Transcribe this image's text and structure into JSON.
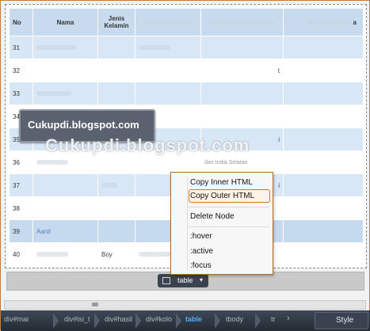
{
  "table": {
    "headers": [
      "No",
      "Nama",
      "Jenis Kelamin",
      "",
      "",
      "a"
    ],
    "rows": [
      {
        "no": "31",
        "c4": ""
      },
      {
        "no": "32",
        "c4": "t"
      },
      {
        "no": "33",
        "c4": ""
      },
      {
        "no": "34",
        "c4": ""
      },
      {
        "no": "35",
        "c4": "i"
      },
      {
        "no": "36",
        "c4": "dan India Selatan"
      },
      {
        "no": "37",
        "c4": "i"
      },
      {
        "no": "38",
        "c4": ""
      },
      {
        "no": "39",
        "c4": ""
      },
      {
        "no": "40",
        "c4": "",
        "gender": "Boy"
      }
    ],
    "row39_name": "Aanil"
  },
  "banner": {
    "text": "Cukupdi.blogspot.com"
  },
  "watermark": {
    "text": "Cukupdi.blogspot.com"
  },
  "context_menu": {
    "items": [
      "Copy Inner HTML",
      "Copy Outer HTML",
      "Delete Node",
      ":hover",
      ":active",
      ":focus"
    ],
    "selected": "Copy Outer HTML"
  },
  "element_pill": {
    "label": "table",
    "icon": "inspect-icon"
  },
  "breadcrumbs": {
    "items": [
      "div#mai",
      "div#isi_t",
      "div#hasil",
      "div#kolo",
      "table",
      "tbody",
      "tr"
    ],
    "active": "table"
  },
  "style_button": {
    "label": "Style"
  },
  "colors": {
    "header": "#c8dbee",
    "alt_row": "#d8e7f6",
    "accent": "#4fb0ff",
    "menu_border": "#b66a22"
  }
}
